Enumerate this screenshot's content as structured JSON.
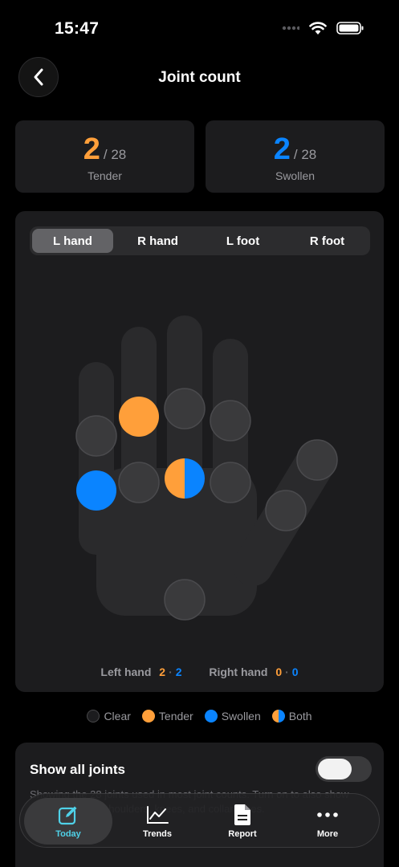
{
  "status": {
    "time": "15:47"
  },
  "nav": {
    "title": "Joint count"
  },
  "stats": {
    "tender": {
      "count": "2",
      "total": "/ 28",
      "label": "Tender",
      "color": "#ff9f3a"
    },
    "swollen": {
      "count": "2",
      "total": "/ 28",
      "label": "Swollen",
      "color": "#0a84ff"
    }
  },
  "segments": [
    {
      "label": "L hand",
      "active": true
    },
    {
      "label": "R hand",
      "active": false
    },
    {
      "label": "L foot",
      "active": false
    },
    {
      "label": "R foot",
      "active": false
    }
  ],
  "hand_joints": [
    {
      "id": "pip-little",
      "state": "clear"
    },
    {
      "id": "pip-ring",
      "state": "tender"
    },
    {
      "id": "pip-middle",
      "state": "clear"
    },
    {
      "id": "pip-index",
      "state": "clear"
    },
    {
      "id": "mcp-little",
      "state": "swollen"
    },
    {
      "id": "mcp-ring",
      "state": "clear"
    },
    {
      "id": "mcp-middle",
      "state": "both"
    },
    {
      "id": "mcp-index",
      "state": "clear"
    },
    {
      "id": "thumb-ip",
      "state": "clear"
    },
    {
      "id": "thumb-mcp",
      "state": "clear"
    },
    {
      "id": "wrist",
      "state": "clear"
    }
  ],
  "summary": {
    "left_label": "Left hand",
    "left_tender": "2",
    "left_swollen": "2",
    "right_label": "Right hand",
    "right_tender": "0",
    "right_swollen": "0",
    "separator": "·"
  },
  "legend": [
    {
      "label": "Clear",
      "kind": "clear"
    },
    {
      "label": "Tender",
      "kind": "tender"
    },
    {
      "label": "Swollen",
      "kind": "swollen"
    },
    {
      "label": "Both",
      "kind": "both"
    }
  ],
  "joints_card": {
    "title": "Show all joints",
    "desc": "Showing the 28 joints used in most joint counts. Turn on to also show feet, toes, hips, shoulders, knees, and collarbones.",
    "toggle_on": false
  },
  "tabs": [
    {
      "label": "Today",
      "icon": "compose-icon",
      "active": true
    },
    {
      "label": "Trends",
      "icon": "chart-icon",
      "active": false
    },
    {
      "label": "Report",
      "icon": "document-icon",
      "active": false
    },
    {
      "label": "More",
      "icon": "ellipsis-icon",
      "active": false
    }
  ],
  "colors": {
    "tender": "#ff9f3a",
    "swollen": "#0a84ff",
    "clear": "#3a3a3c",
    "accent": "#4fd1e8"
  }
}
